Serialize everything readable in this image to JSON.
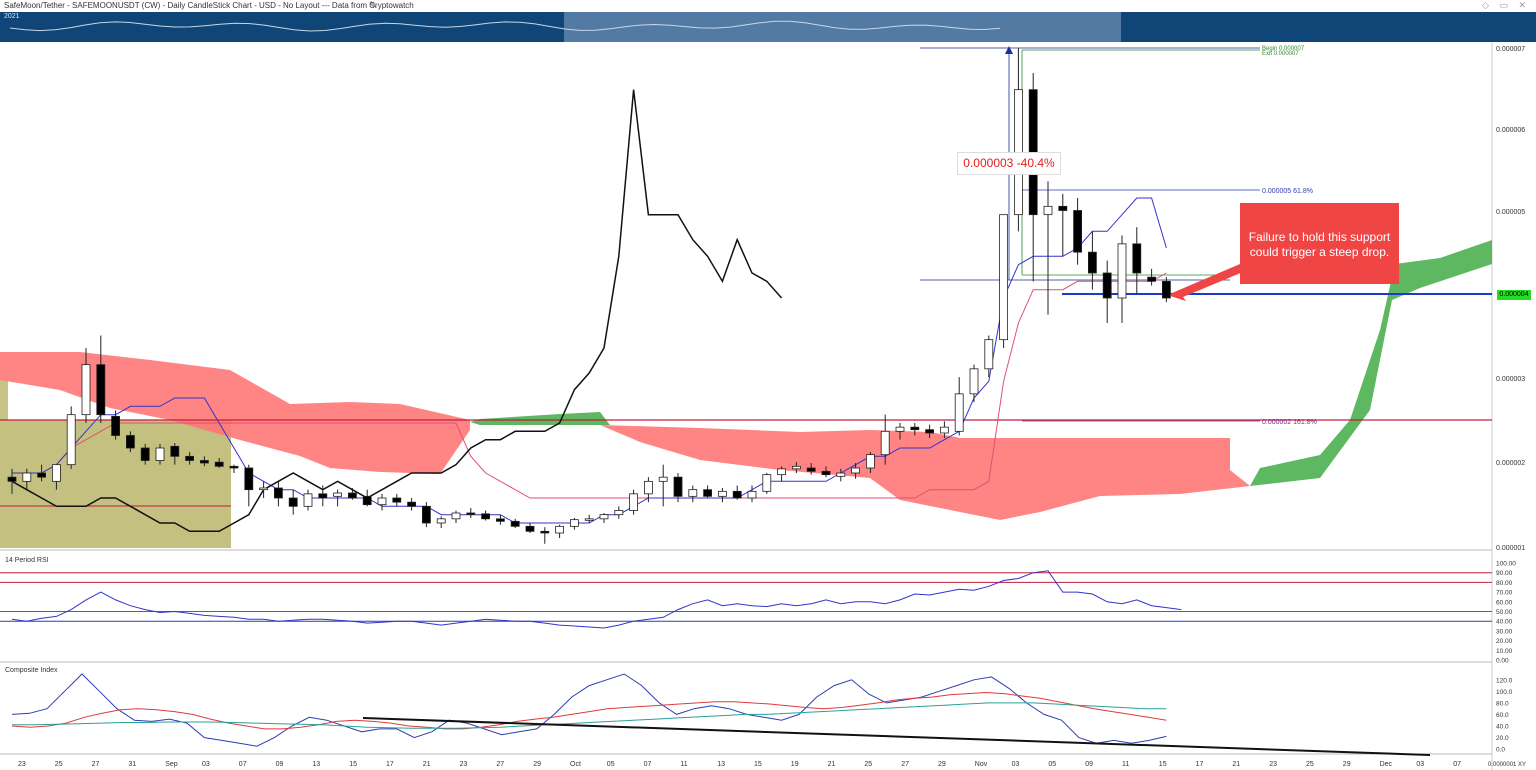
{
  "header": {
    "title": "SafeMoon/Tether - SAFEMOONUSDT (CW) - Daily CandleStick Chart - USD - No Layout --- Data from Cryptowatch",
    "nav_year": "2021",
    "window_icons": "◇ ▭ ✕"
  },
  "annotations": {
    "callout_text": "Failure to hold this support could trigger a steep drop.",
    "measure_text": "0.000003  -40.4%",
    "fib_1_price": "0.000005",
    "fib_1_pct": "61.8%",
    "fib_2_price": "0.000002",
    "fib_2_pct": "161.8%",
    "top_label_1": "Begin 0.000007",
    "top_label_2": "Exit 0.000007",
    "current_price": "0.000004",
    "corner_label": "0.0000001 XY"
  },
  "colors": {
    "bull_cloud": "#4caf50",
    "bear_cloud": "#ff6b6b",
    "tenkan": "#3333cc",
    "kijun": "#e05070",
    "support": "#1e3acc",
    "callout": "#f04545",
    "nav": "#0f4577"
  },
  "chart_data": [
    {
      "type": "candlestick",
      "title": "SafeMoon/Tether - SAFEMOONUSDT (CW) - Daily CandleStick Chart - USD",
      "y_ticks": [
        "0.000007",
        "0.000006",
        "0.000005",
        "0.000003",
        "0.000002",
        "0.000001"
      ],
      "x_ticks": [
        "23",
        "25",
        "27",
        "31",
        "Sep",
        "03",
        "07",
        "09",
        "13",
        "15",
        "17",
        "21",
        "23",
        "27",
        "29",
        "Oct",
        "05",
        "07",
        "11",
        "13",
        "15",
        "19",
        "21",
        "25",
        "27",
        "29",
        "Nov",
        "03",
        "05",
        "09",
        "11",
        "15",
        "17",
        "21",
        "23",
        "25",
        "29",
        "Dec",
        "03",
        "07"
      ],
      "ylim": [
        1e-06,
        7e-06
      ],
      "candles": [
        {
          "o": 1.85e-06,
          "h": 1.95e-06,
          "l": 1.65e-06,
          "c": 1.8e-06
        },
        {
          "o": 1.8e-06,
          "h": 1.95e-06,
          "l": 1.7e-06,
          "c": 1.9e-06
        },
        {
          "o": 1.9e-06,
          "h": 2e-06,
          "l": 1.8e-06,
          "c": 1.85e-06
        },
        {
          "o": 1.8e-06,
          "h": 2e-06,
          "l": 1.7e-06,
          "c": 2e-06
        },
        {
          "o": 2e-06,
          "h": 2.7e-06,
          "l": 1.95e-06,
          "c": 2.6e-06
        },
        {
          "o": 2.6e-06,
          "h": 3.4e-06,
          "l": 2.5e-06,
          "c": 3.2e-06
        },
        {
          "o": 3.2e-06,
          "h": 3.55e-06,
          "l": 2.5e-06,
          "c": 2.6e-06
        },
        {
          "o": 2.58e-06,
          "h": 2.65e-06,
          "l": 2.3e-06,
          "c": 2.35e-06
        },
        {
          "o": 2.35e-06,
          "h": 2.4e-06,
          "l": 2.15e-06,
          "c": 2.2e-06
        },
        {
          "o": 2.2e-06,
          "h": 2.25e-06,
          "l": 2e-06,
          "c": 2.05e-06
        },
        {
          "o": 2.05e-06,
          "h": 2.25e-06,
          "l": 2e-06,
          "c": 2.2e-06
        },
        {
          "o": 2.22e-06,
          "h": 2.26e-06,
          "l": 2e-06,
          "c": 2.1e-06
        },
        {
          "o": 2.1e-06,
          "h": 2.15e-06,
          "l": 2e-06,
          "c": 2.05e-06
        },
        {
          "o": 2.05e-06,
          "h": 2.1e-06,
          "l": 1.98e-06,
          "c": 2.02e-06
        },
        {
          "o": 2.03e-06,
          "h": 2.08e-06,
          "l": 1.96e-06,
          "c": 1.98e-06
        },
        {
          "o": 1.98e-06,
          "h": 2e-06,
          "l": 1.9e-06,
          "c": 1.96e-06
        },
        {
          "o": 1.96e-06,
          "h": 2e-06,
          "l": 1.5e-06,
          "c": 1.7e-06
        },
        {
          "o": 1.7e-06,
          "h": 1.8e-06,
          "l": 1.6e-06,
          "c": 1.72e-06
        },
        {
          "o": 1.72e-06,
          "h": 1.8e-06,
          "l": 1.5e-06,
          "c": 1.6e-06
        },
        {
          "o": 1.6e-06,
          "h": 1.7e-06,
          "l": 1.4e-06,
          "c": 1.5e-06
        },
        {
          "o": 1.5e-06,
          "h": 1.7e-06,
          "l": 1.45e-06,
          "c": 1.65e-06
        },
        {
          "o": 1.65e-06,
          "h": 1.75e-06,
          "l": 1.5e-06,
          "c": 1.6e-06
        },
        {
          "o": 1.62e-06,
          "h": 1.7e-06,
          "l": 1.5e-06,
          "c": 1.66e-06
        },
        {
          "o": 1.66e-06,
          "h": 1.72e-06,
          "l": 1.58e-06,
          "c": 1.6e-06
        },
        {
          "o": 1.62e-06,
          "h": 1.7e-06,
          "l": 1.5e-06,
          "c": 1.52e-06
        },
        {
          "o": 1.52e-06,
          "h": 1.65e-06,
          "l": 1.45e-06,
          "c": 1.6e-06
        },
        {
          "o": 1.6e-06,
          "h": 1.65e-06,
          "l": 1.5e-06,
          "c": 1.55e-06
        },
        {
          "o": 1.55e-06,
          "h": 1.6e-06,
          "l": 1.45e-06,
          "c": 1.5e-06
        },
        {
          "o": 1.5e-06,
          "h": 1.55e-06,
          "l": 1.25e-06,
          "c": 1.3e-06
        },
        {
          "o": 1.3e-06,
          "h": 1.38e-06,
          "l": 1.24e-06,
          "c": 1.35e-06
        },
        {
          "o": 1.35e-06,
          "h": 1.45e-06,
          "l": 1.3e-06,
          "c": 1.42e-06
        },
        {
          "o": 1.42e-06,
          "h": 1.48e-06,
          "l": 1.36e-06,
          "c": 1.41e-06
        },
        {
          "o": 1.41e-06,
          "h": 1.45e-06,
          "l": 1.33e-06,
          "c": 1.35e-06
        },
        {
          "o": 1.35e-06,
          "h": 1.4e-06,
          "l": 1.28e-06,
          "c": 1.32e-06
        },
        {
          "o": 1.32e-06,
          "h": 1.35e-06,
          "l": 1.24e-06,
          "c": 1.26e-06
        },
        {
          "o": 1.26e-06,
          "h": 1.3e-06,
          "l": 1.18e-06,
          "c": 1.2e-06
        },
        {
          "o": 1.2e-06,
          "h": 1.25e-06,
          "l": 1.05e-06,
          "c": 1.18e-06
        },
        {
          "o": 1.18e-06,
          "h": 1.28e-06,
          "l": 1.12e-06,
          "c": 1.26e-06
        },
        {
          "o": 1.26e-06,
          "h": 1.36e-06,
          "l": 1.22e-06,
          "c": 1.34e-06
        },
        {
          "o": 1.34e-06,
          "h": 1.4e-06,
          "l": 1.3e-06,
          "c": 1.35e-06
        },
        {
          "o": 1.35e-06,
          "h": 1.42e-06,
          "l": 1.3e-06,
          "c": 1.4e-06
        },
        {
          "o": 1.4e-06,
          "h": 1.5e-06,
          "l": 1.35e-06,
          "c": 1.45e-06
        },
        {
          "o": 1.45e-06,
          "h": 1.7e-06,
          "l": 1.4e-06,
          "c": 1.65e-06
        },
        {
          "o": 1.65e-06,
          "h": 1.85e-06,
          "l": 1.55e-06,
          "c": 1.8e-06
        },
        {
          "o": 1.8e-06,
          "h": 2e-06,
          "l": 1.5e-06,
          "c": 1.85e-06
        },
        {
          "o": 1.85e-06,
          "h": 1.9e-06,
          "l": 1.55e-06,
          "c": 1.62e-06
        },
        {
          "o": 1.62e-06,
          "h": 1.75e-06,
          "l": 1.55e-06,
          "c": 1.7e-06
        },
        {
          "o": 1.7e-06,
          "h": 1.75e-06,
          "l": 1.6e-06,
          "c": 1.62e-06
        },
        {
          "o": 1.62e-06,
          "h": 1.72e-06,
          "l": 1.55e-06,
          "c": 1.68e-06
        },
        {
          "o": 1.68e-06,
          "h": 1.75e-06,
          "l": 1.58e-06,
          "c": 1.6e-06
        },
        {
          "o": 1.6e-06,
          "h": 1.75e-06,
          "l": 1.55e-06,
          "c": 1.68e-06
        },
        {
          "o": 1.68e-06,
          "h": 1.9e-06,
          "l": 1.65e-06,
          "c": 1.88e-06
        },
        {
          "o": 1.88e-06,
          "h": 1.98e-06,
          "l": 1.8e-06,
          "c": 1.95e-06
        },
        {
          "o": 1.95e-06,
          "h": 2.03e-06,
          "l": 1.9e-06,
          "c": 1.98e-06
        },
        {
          "o": 1.96e-06,
          "h": 2.02e-06,
          "l": 1.88e-06,
          "c": 1.92e-06
        },
        {
          "o": 1.92e-06,
          "h": 1.98e-06,
          "l": 1.85e-06,
          "c": 1.88e-06
        },
        {
          "o": 1.86e-06,
          "h": 1.95e-06,
          "l": 1.8e-06,
          "c": 1.9e-06
        },
        {
          "o": 1.9e-06,
          "h": 2.02e-06,
          "l": 1.83e-06,
          "c": 1.96e-06
        },
        {
          "o": 1.96e-06,
          "h": 2.15e-06,
          "l": 1.9e-06,
          "c": 2.12e-06
        },
        {
          "o": 2.12e-06,
          "h": 2.6e-06,
          "l": 2e-06,
          "c": 2.4e-06
        },
        {
          "o": 2.4e-06,
          "h": 2.5e-06,
          "l": 2.3e-06,
          "c": 2.45e-06
        },
        {
          "o": 2.45e-06,
          "h": 2.5e-06,
          "l": 2.35e-06,
          "c": 2.42e-06
        },
        {
          "o": 2.42e-06,
          "h": 2.48e-06,
          "l": 2.32e-06,
          "c": 2.38e-06
        },
        {
          "o": 2.38e-06,
          "h": 2.52e-06,
          "l": 2.32e-06,
          "c": 2.45e-06
        },
        {
          "o": 2.4e-06,
          "h": 3.05e-06,
          "l": 2.35e-06,
          "c": 2.85e-06
        },
        {
          "o": 2.85e-06,
          "h": 3.2e-06,
          "l": 2.75e-06,
          "c": 3.15e-06
        },
        {
          "o": 3.15e-06,
          "h": 3.55e-06,
          "l": 3.05e-06,
          "c": 3.5e-06
        },
        {
          "o": 3.5e-06,
          "h": 4.2e-06,
          "l": 3.4e-06,
          "c": 5e-06
        },
        {
          "o": 5e-06,
          "h": 7e-06,
          "l": 4.8e-06,
          "c": 6.5e-06
        },
        {
          "o": 6.5e-06,
          "h": 6.7e-06,
          "l": 4.2e-06,
          "c": 5e-06
        },
        {
          "o": 5e-06,
          "h": 5.4e-06,
          "l": 3.8e-06,
          "c": 5.1e-06
        },
        {
          "o": 5.1e-06,
          "h": 5.25e-06,
          "l": 4.5e-06,
          "c": 5.05e-06
        },
        {
          "o": 5.05e-06,
          "h": 5.2e-06,
          "l": 4.4e-06,
          "c": 4.55e-06
        },
        {
          "o": 4.55e-06,
          "h": 4.8e-06,
          "l": 4.1e-06,
          "c": 4.3e-06
        },
        {
          "o": 4.3e-06,
          "h": 4.45e-06,
          "l": 3.7e-06,
          "c": 4e-06
        },
        {
          "o": 4e-06,
          "h": 4.75e-06,
          "l": 3.7e-06,
          "c": 4.65e-06
        },
        {
          "o": 4.65e-06,
          "h": 4.85e-06,
          "l": 4.05e-06,
          "c": 4.3e-06
        },
        {
          "o": 4.25e-06,
          "h": 4.35e-06,
          "l": 4.15e-06,
          "c": 4.2e-06
        },
        {
          "o": 4.2e-06,
          "h": 4.25e-06,
          "l": 3.95e-06,
          "c": 4e-06
        }
      ],
      "tenkan": [
        1.9e-06,
        1.9e-06,
        1.9e-06,
        2e-06,
        2.2e-06,
        2.4e-06,
        2.6e-06,
        2.6e-06,
        2.7e-06,
        2.7e-06,
        2.7e-06,
        2.8e-06,
        2.8e-06,
        2.8e-06,
        2.5e-06,
        2.2e-06,
        1.9e-06,
        1.8e-06,
        1.7e-06,
        1.7e-06,
        1.6e-06,
        1.6e-06,
        1.6e-06,
        1.6e-06,
        1.6e-06,
        1.5e-06,
        1.5e-06,
        1.5e-06,
        1.5e-06,
        1.4e-06,
        1.4e-06,
        1.4e-06,
        1.4e-06,
        1.4e-06,
        1.3e-06,
        1.3e-06,
        1.3e-06,
        1.3e-06,
        1.3e-06,
        1.3e-06,
        1.4e-06,
        1.4e-06,
        1.5e-06,
        1.6e-06,
        1.6e-06,
        1.6e-06,
        1.6e-06,
        1.6e-06,
        1.6e-06,
        1.6e-06,
        1.7e-06,
        1.8e-06,
        1.8e-06,
        1.8e-06,
        1.8e-06,
        1.8e-06,
        1.9e-06,
        2e-06,
        2.1e-06,
        2.1e-06,
        2.2e-06,
        2.2e-06,
        2.2e-06,
        2.3e-06,
        2.4e-06,
        2.8e-06,
        3e-06,
        4e-06,
        4.4e-06,
        4.5e-06,
        4.5e-06,
        4.5e-06,
        4.6e-06,
        4.8e-06,
        4.8e-06,
        5e-06,
        5.2e-06,
        5.2e-06,
        4.6e-06
      ],
      "kijun": [
        1.9e-06,
        1.9e-06,
        1.9e-06,
        2e-06,
        2.2e-06,
        2.3e-06,
        2.4e-06,
        2.5e-06,
        2.5e-06,
        2.5e-06,
        2.5e-06,
        2.5e-06,
        2.5e-06,
        2.5e-06,
        2.5e-06,
        2.5e-06,
        2.5e-06,
        2.5e-06,
        2.5e-06,
        2.5e-06,
        2.5e-06,
        2.5e-06,
        2.5e-06,
        2.5e-06,
        2.5e-06,
        2.5e-06,
        2.5e-06,
        2.5e-06,
        2.5e-06,
        2.5e-06,
        2.5e-06,
        2.1e-06,
        1.9e-06,
        1.8e-06,
        1.7e-06,
        1.6e-06,
        1.6e-06,
        1.6e-06,
        1.6e-06,
        1.6e-06,
        1.6e-06,
        1.6e-06,
        1.6e-06,
        1.6e-06,
        1.6e-06,
        1.6e-06,
        1.6e-06,
        1.6e-06,
        1.6e-06,
        1.6e-06,
        1.6e-06,
        1.6e-06,
        1.6e-06,
        1.6e-06,
        1.6e-06,
        1.6e-06,
        1.6e-06,
        1.6e-06,
        1.6e-06,
        1.6e-06,
        1.6e-06,
        1.6e-06,
        1.7e-06,
        1.7e-06,
        1.7e-06,
        1.7e-06,
        1.8e-06,
        3e-06,
        3.7e-06,
        4.1e-06,
        4.1e-06,
        4.1e-06,
        4.2e-06,
        4.2e-06,
        4.2e-06,
        4.2e-06,
        4.2e-06,
        4.2e-06,
        4.3e-06
      ],
      "chikou": [
        1.8e-06,
        1.7e-06,
        1.6e-06,
        1.5e-06,
        1.5e-06,
        1.5e-06,
        1.6e-06,
        1.6e-06,
        1.5e-06,
        1.4e-06,
        1.3e-06,
        1.3e-06,
        1.2e-06,
        1.2e-06,
        1.2e-06,
        1.3e-06,
        1.4e-06,
        1.7e-06,
        1.8e-06,
        1.9e-06,
        1.8e-06,
        1.7e-06,
        1.8e-06,
        1.7e-06,
        1.6e-06,
        1.7e-06,
        1.8e-06,
        1.9e-06,
        1.9e-06,
        1.9e-06,
        2e-06,
        2.2e-06,
        2.3e-06,
        2.3e-06,
        2.4e-06,
        2.4e-06,
        2.4e-06,
        2.5e-06,
        2.9e-06,
        3.1e-06,
        3.4e-06,
        4.5e-06,
        6.5e-06,
        5e-06,
        5e-06,
        5e-06,
        4.7e-06,
        4.5e-06,
        4.2e-06,
        4.7e-06,
        4.3e-06,
        4.2e-06,
        4e-06
      ],
      "support_level": 4e-06,
      "resistance_level": 2.5e-06
    },
    {
      "type": "line",
      "title": "14 Period RSI",
      "y_ticks": [
        "100.00",
        "90.00",
        "80.00",
        "70.00",
        "60.00",
        "50.00",
        "40.00",
        "30.00",
        "20.00",
        "10.00",
        "0.00"
      ],
      "ylim": [
        0,
        100
      ],
      "levels": [
        90,
        80,
        50,
        40
      ],
      "values": [
        42,
        40,
        43,
        45,
        52,
        62,
        70,
        62,
        56,
        52,
        49,
        50,
        48,
        46,
        45,
        44,
        42,
        42,
        40,
        41,
        42,
        42,
        41,
        40,
        38,
        39,
        40,
        40,
        38,
        36,
        38,
        40,
        42,
        41,
        40,
        40,
        38,
        36,
        35,
        34,
        33,
        36,
        40,
        42,
        44,
        52,
        58,
        62,
        56,
        58,
        56,
        55,
        58,
        56,
        58,
        62,
        58,
        60,
        60,
        58,
        62,
        68,
        67,
        70,
        73,
        72,
        76,
        82,
        84,
        90,
        92,
        70,
        70,
        68,
        60,
        58,
        62,
        56,
        54,
        52
      ]
    },
    {
      "type": "line",
      "title": "Composite Index",
      "y_ticks": [
        "120.0",
        "100.0",
        "80.0",
        "60.0",
        "40.0",
        "20.0",
        "0.0"
      ],
      "ylim": [
        -5,
        130
      ],
      "series": [
        {
          "values": [
            60,
            62,
            70,
            100,
            130,
            100,
            70,
            50,
            48,
            52,
            45,
            20,
            15,
            10,
            5,
            20,
            40,
            55,
            50,
            40,
            30,
            35,
            35,
            20,
            30,
            50,
            45,
            35,
            25,
            30,
            35,
            60,
            90,
            110,
            120,
            130,
            110,
            80,
            60,
            70,
            75,
            70,
            60,
            55,
            50,
            60,
            90,
            110,
            120,
            95,
            80,
            85,
            90,
            100,
            110,
            120,
            125,
            105,
            80,
            60,
            50,
            20,
            10,
            15,
            10,
            15,
            22
          ]
        },
        {
          "values": [
            40,
            38,
            40,
            45,
            55,
            62,
            68,
            70,
            68,
            65,
            60,
            52,
            45,
            40,
            35,
            35,
            38,
            42,
            48,
            50,
            48,
            45,
            40,
            38,
            35,
            35,
            38,
            42,
            48,
            52,
            55,
            60,
            65,
            70,
            72,
            74,
            76,
            78,
            80,
            82,
            82,
            80,
            78,
            75,
            72,
            70,
            72,
            76,
            80,
            85,
            88,
            90,
            94,
            96,
            98,
            96,
            92,
            88,
            82,
            76,
            70,
            65,
            60,
            55,
            50
          ]
        },
        {
          "values": [
            42,
            42,
            43,
            44,
            45,
            46,
            46,
            47,
            47,
            47,
            46,
            45,
            44,
            43,
            42,
            40,
            38,
            37,
            36,
            36,
            36,
            37,
            38,
            40,
            42,
            44,
            46,
            48,
            50,
            52,
            54,
            56,
            58,
            60,
            60,
            62,
            64,
            66,
            68,
            70,
            72,
            74,
            76,
            78,
            80,
            80,
            80,
            78,
            76,
            74,
            72,
            70,
            70
          ]
        }
      ],
      "trendline": [
        [
          55,
          2
        ],
        [
          9999,
          0
        ]
      ]
    }
  ]
}
